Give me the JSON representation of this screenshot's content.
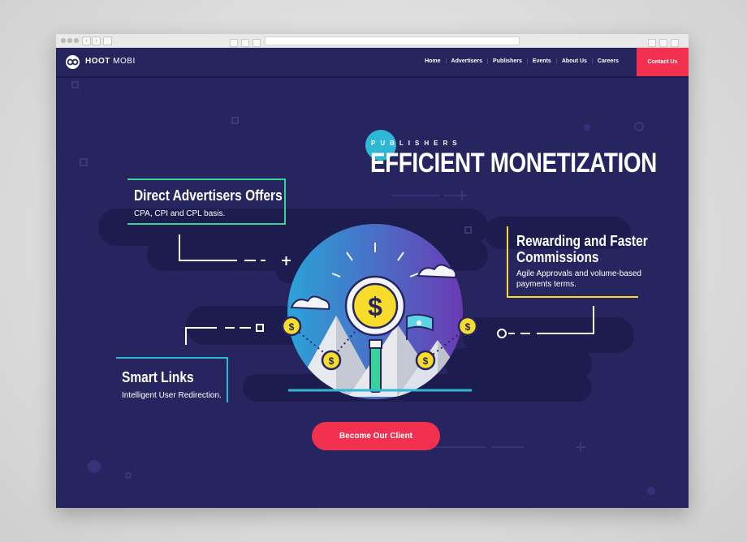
{
  "site": {
    "logo_text_bold": "HOOT",
    "logo_text": "MOBI"
  },
  "nav": {
    "items": [
      "Home",
      "Advertisers",
      "Publishers",
      "Events",
      "About Us",
      "Careers"
    ],
    "contact_label": "Contact Us"
  },
  "hero": {
    "kicker": "PUBLISHERS",
    "headline": "EFFICIENT MONETIZATION",
    "cta_label": "Become Our Client"
  },
  "features": [
    {
      "title": "Direct Advertisers Offers",
      "desc": "CPA, CPI and CPL basis."
    },
    {
      "title_line1": "Rewarding and Faster",
      "title_line2": "Commissions",
      "desc_line1": "Agile Approvals and volume-based",
      "desc_line2": "payments terms."
    },
    {
      "title": "Smart Links",
      "desc": "Intelligent User Redirection."
    }
  ],
  "colors": {
    "background": "#262560",
    "accent_red": "#f2304f",
    "accent_green": "#37d49a",
    "accent_yellow": "#f7dc2b",
    "accent_cyan": "#2fb7d6"
  },
  "icons": [
    "dollar-coin-icon",
    "flag-icon",
    "cloud-icon",
    "search-magnifier-icon"
  ]
}
